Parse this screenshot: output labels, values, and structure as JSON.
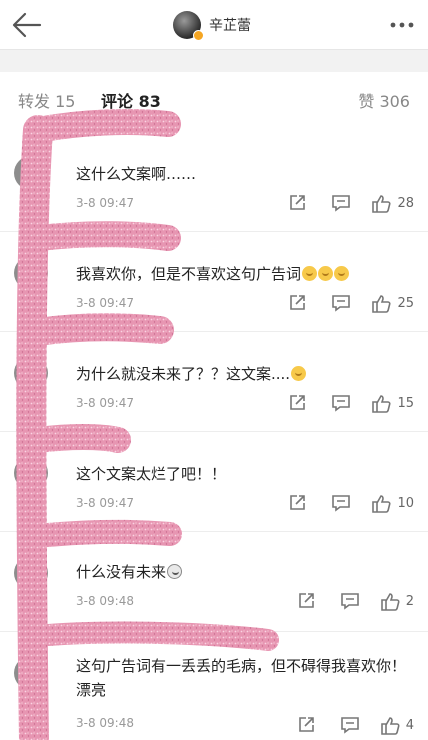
{
  "header": {
    "profile_name": "辛芷蕾"
  },
  "tabs": {
    "repost": "转发 15",
    "comments": "评论 83",
    "likes": "赞 306"
  },
  "comments": [
    {
      "text": "这什么文案啊……",
      "time": "3-8 09:47",
      "likes": "28"
    },
    {
      "text": "我喜欢你，但是不喜欢这句广告词",
      "time": "3-8 09:47",
      "likes": "25"
    },
    {
      "text": "为什么就没未来了？？这文案....",
      "time": "3-8 09:47",
      "likes": "15"
    },
    {
      "text": "这个文案太烂了吧！！",
      "time": "3-8 09:47",
      "likes": "10"
    },
    {
      "text": "什么没有未来",
      "time": "3-8 09:48",
      "likes": "2"
    },
    {
      "text": "这句广告词有一丢丢的毛病，但不碍得我喜欢你！漂亮",
      "time": "3-8 09:48",
      "likes": "4"
    }
  ],
  "colors": {
    "accent": "#ff8200",
    "redaction": "#e89ab4"
  }
}
